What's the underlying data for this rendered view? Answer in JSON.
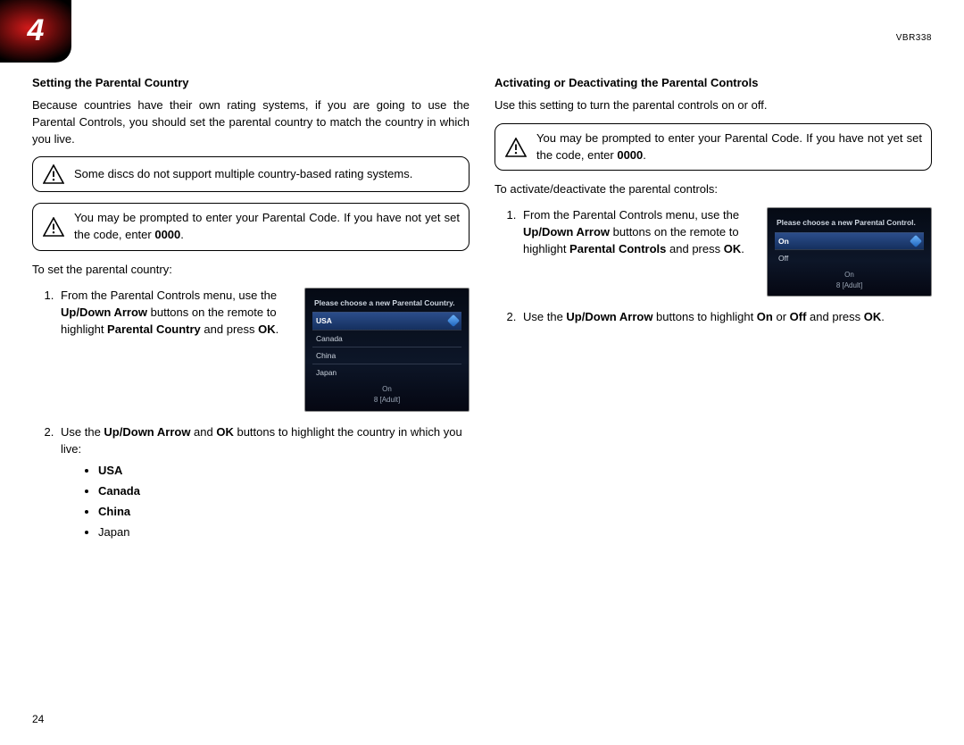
{
  "header": {
    "chapter_number": "4",
    "model": "VBR338"
  },
  "page_number": "24",
  "left": {
    "heading": "Setting the Parental Country",
    "intro": "Because countries have their own rating systems, if you are going to use the Parental Controls, you should set the parental country to match the country in which you live.",
    "warn1": "Some discs do not support multiple country-based rating systems.",
    "warn2_a": "You may be prompted to enter your Parental Code. If you have not yet set the code, enter ",
    "warn2_b": "0000",
    "warn2_c": ".",
    "instr": "To set the parental country:",
    "step1_a": "From the Parental Controls menu, use the ",
    "step1_b": "Up/Down Arrow",
    "step1_c": " buttons on the remote to highlight ",
    "step1_d": "Parental Country",
    "step1_e": " and press ",
    "step1_f": "OK",
    "step1_g": ".",
    "step2_a": "Use the ",
    "step2_b": "Up/Down Arrow",
    "step2_c": " and ",
    "step2_d": "OK",
    "step2_e": " buttons to highlight the country in which you live:",
    "bullet1": "USA",
    "bullet2": "Canada",
    "bullet3": "China",
    "bullet4": "Japan",
    "mini": {
      "title": "Please choose a new Parental Country.",
      "opt1": "USA",
      "opt2": "Canada",
      "opt3": "China",
      "opt4": "Japan",
      "foot_on": "On",
      "foot_rating": "8 [Adult]"
    }
  },
  "right": {
    "heading": "Activating or Deactivating the Parental Controls",
    "intro": "Use this setting to turn the parental controls on or off.",
    "warn_a": "You may be prompted to enter your Parental Code. If you have not yet set the code, enter ",
    "warn_b": "0000",
    "warn_c": ".",
    "instr": "To activate/deactivate the parental controls:",
    "step1_a": "From the Parental Controls menu, use the ",
    "step1_b": "Up/Down Arrow",
    "step1_c": " buttons on the remote to highlight ",
    "step1_d": "Parental Controls",
    "step1_e": " and press ",
    "step1_f": "OK",
    "step1_g": ".",
    "step2_a": "Use the ",
    "step2_b": "Up/Down Arrow",
    "step2_c": " buttons to highlight ",
    "step2_d": "On",
    "step2_e": " or ",
    "step2_f": "Off",
    "step2_g": " and press ",
    "step2_h": "OK",
    "step2_i": ".",
    "mini": {
      "title": "Please choose a new Parental Control.",
      "opt1": "On",
      "opt2": "Off",
      "foot_on": "On",
      "foot_rating": "8 [Adult]"
    }
  }
}
